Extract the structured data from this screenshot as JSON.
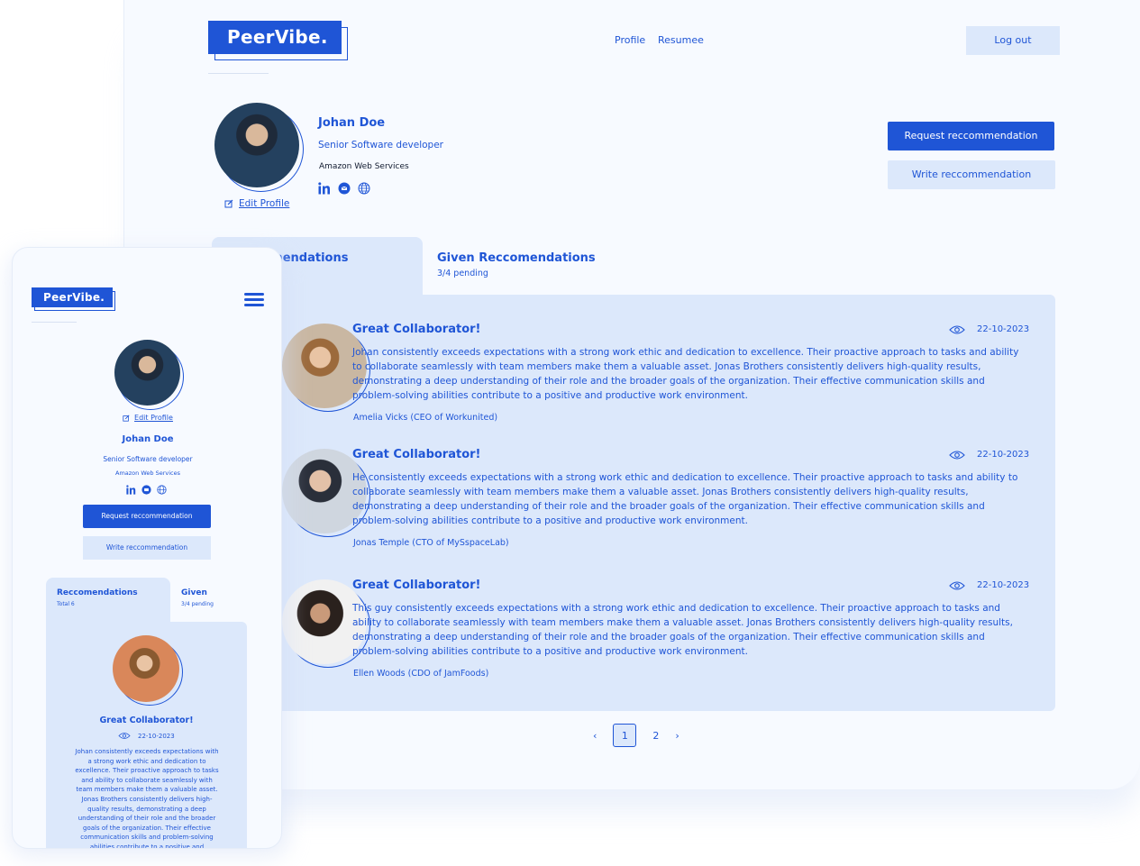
{
  "brand": {
    "name": "PeerVibe."
  },
  "nav": {
    "profile": "Profile",
    "resume": "Resumee",
    "logout": "Log out"
  },
  "profile": {
    "name": "Johan Doe",
    "title": "Senior Software developer",
    "company": "Amazon Web Services",
    "edit_label": "Edit Profile"
  },
  "actions": {
    "request": "Request reccommendation",
    "write": "Write reccommendation"
  },
  "tabs": {
    "received": {
      "label": "Reccomendations",
      "sub": "Total 6"
    },
    "given": {
      "label": "Given Reccomendations",
      "sub": "3/4 pending"
    },
    "given_short": {
      "label": "Given",
      "sub": "3/4 pending"
    }
  },
  "recommendations": [
    {
      "title": "Great Collaborator!",
      "date": "22-10-2023",
      "body": "Johan consistently exceeds expectations with a strong work ethic and dedication to excellence. Their proactive approach to tasks and ability to collaborate seamlessly with team members make them a valuable asset. Jonas Brothers consistently delivers high-quality results, demonstrating a deep understanding of their role and the broader goals of the organization. Their effective communication skills and problem-solving abilities contribute to a positive and productive work environment.",
      "author": "Amelia Vicks (CEO of Workunited)"
    },
    {
      "title": "Great Collaborator!",
      "date": "22-10-2023",
      "body": "He consistently exceeds expectations with a strong work ethic and dedication to excellence. Their proactive approach to tasks and ability to collaborate seamlessly with team members make them a valuable asset. Jonas Brothers consistently delivers high-quality results, demonstrating a deep understanding of their role and the broader goals of the organization. Their effective communication skills and problem-solving abilities contribute to a positive and productive work environment.",
      "author": "Jonas Temple (CTO of MySspaceLab)"
    },
    {
      "title": "Great Collaborator!",
      "date": "22-10-2023",
      "body": "This guy consistently exceeds expectations with a strong work ethic and dedication to excellence. Their proactive approach to tasks and ability to collaborate seamlessly with team members make them a valuable asset. Jonas Brothers consistently delivers high-quality results, demonstrating a deep understanding of their role and the broader goals of the organization. Their effective communication skills and problem-solving abilities contribute to a positive and productive work environment.",
      "author": "Ellen Woods (CDO of JamFoods)"
    }
  ],
  "mobile_card": {
    "title": "Great Collaborator!",
    "date": "22-10-2023",
    "body": "Johan consistently exceeds expectations with a strong work ethic and dedication to excellence. Their proactive approach to tasks and ability to collaborate seamlessly with team members make them a valuable asset. Jonas Brothers consistently delivers high-quality results, demonstrating a deep understanding of their role and the broader goals of the organization. Their effective communication skills and problem-solving abilities contribute to a positive and"
  },
  "pagination": {
    "prev": "‹",
    "pages": [
      "1",
      "2"
    ],
    "next": "›",
    "current": "1"
  },
  "icons": {
    "linkedin": "linkedin-icon",
    "mail": "mail-icon",
    "web": "globe-icon",
    "edit": "edit-icon",
    "eye": "eye-icon",
    "menu": "hamburger-icon"
  },
  "colors": {
    "primary": "#1f55d6",
    "panel": "#dce8fb",
    "background": "#f7faff"
  }
}
